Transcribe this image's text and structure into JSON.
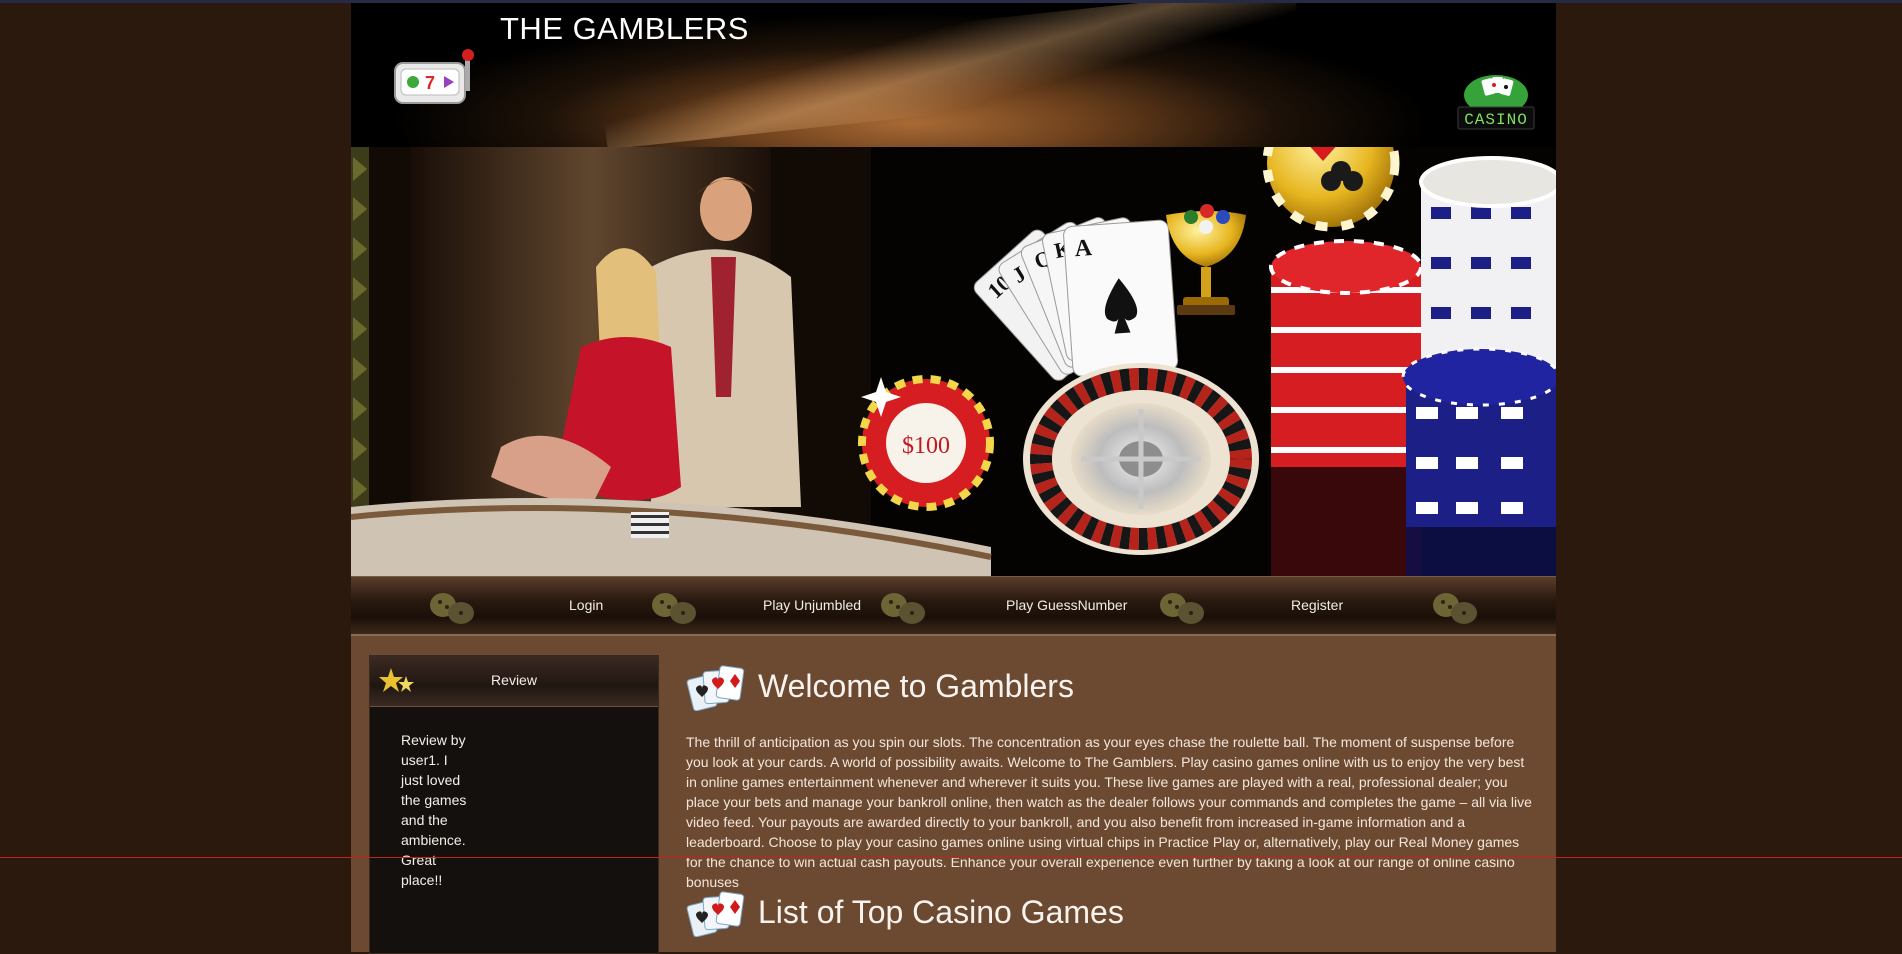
{
  "header": {
    "title": "THE GAMBLERS"
  },
  "banner": {
    "chip_label": "$100",
    "cards": [
      "10",
      "J",
      "Q",
      "K",
      "A"
    ]
  },
  "nav": {
    "items": [
      "Login",
      "Play Unjumbled",
      "Play GuessNumber",
      "Register"
    ]
  },
  "sidebar": {
    "title": "Review",
    "review": "Review by user1. I just loved the games and the ambience. Great place!!"
  },
  "main": {
    "welcome_heading": "Welcome to Gamblers",
    "intro": "The thrill of anticipation as you spin our slots. The concentration as your eyes chase the roulette ball. The moment of suspense before you look at your cards. A world of possibility awaits. Welcome to The Gamblers. Play casino games online with us to enjoy the very best in online games entertainment whenever and wherever it suits you. These live games are played with a real, professional dealer; you place your bets and manage your bankroll online, then watch as the dealer follows your commands and completes the game – all via live video feed. Your payouts are awarded directly to your bankroll, and you also benefit from increased in-game information and a leaderboard. Choose to play your casino games online using virtual chips in Practice Play or, alternatively, play our Real Money games for the chance to win actual cash payouts. Enhance your overall experience even further by taking a look at our range of online casino bonuses",
    "games_heading": "List of Top Casino Games"
  },
  "colors": {
    "page_bg": "#2a190c",
    "content_bg": "#6c4a32",
    "sidebar_bg": "#14100d",
    "chip_red": "#d51d22",
    "chip_blue": "#1c1f86",
    "gold": "#e7b620"
  },
  "icons": [
    "slot-machine-icon",
    "casino-sign-icon",
    "coin-stack-icon",
    "star-icon",
    "playing-cards-icon"
  ]
}
